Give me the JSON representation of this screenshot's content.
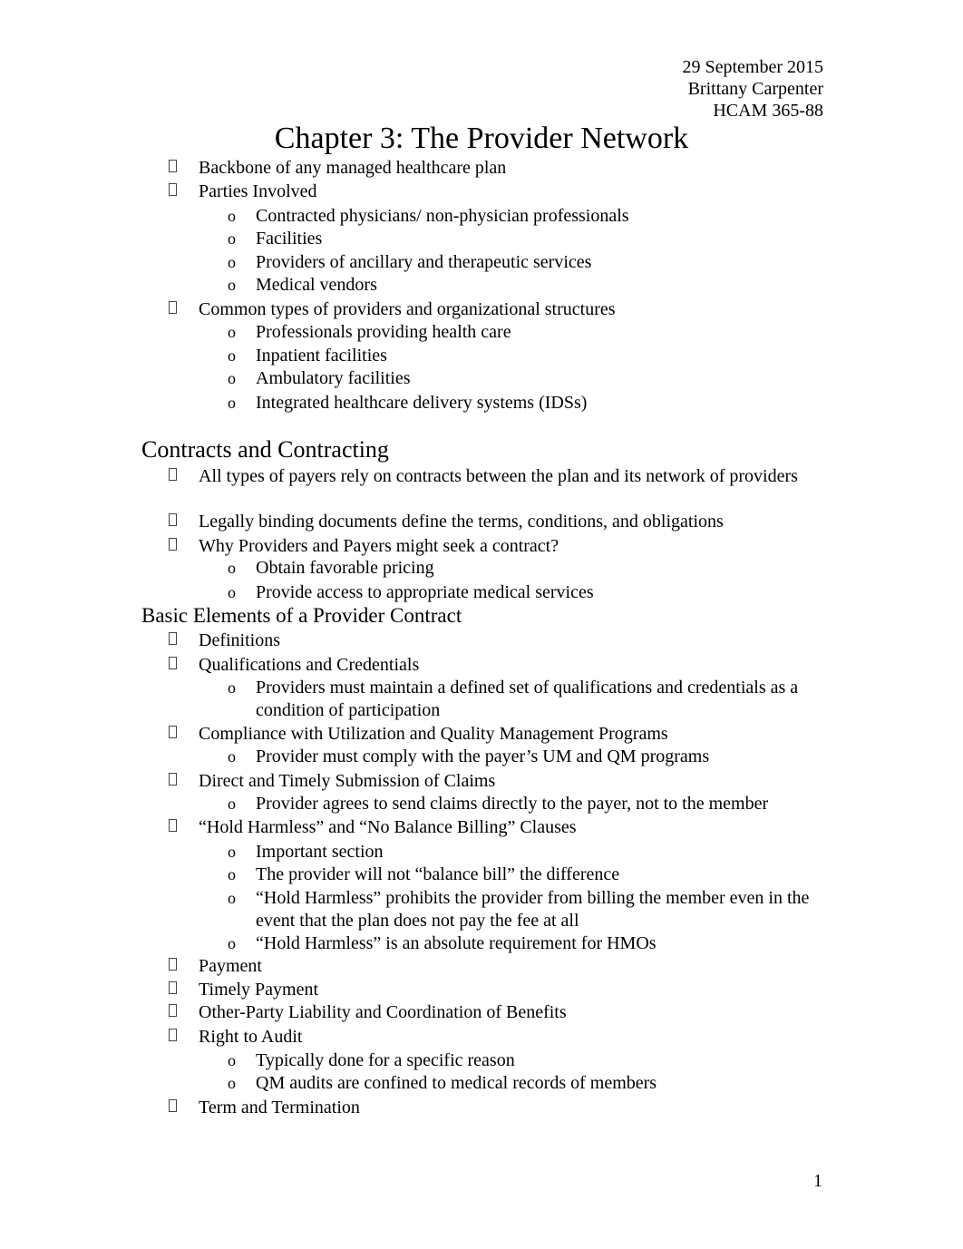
{
  "header": {
    "date": "29 September 2015",
    "author": "Brittany Carpenter",
    "course": "HCAM 365-88"
  },
  "title": "Chapter 3: The Provider Network",
  "bullet_glyphs": {
    "level1": "missing-glyph-box",
    "level2": "o"
  },
  "sections": [
    {
      "heading": "",
      "items": [
        {
          "text": "Backbone of any managed healthcare plan",
          "sub": []
        },
        {
          "text": "Parties Involved",
          "sub": [
            "Contracted physicians/ non-physician professionals",
            "Facilities",
            "Providers of ancillary and therapeutic services",
            "Medical vendors"
          ]
        },
        {
          "text": "Common types of providers and organizational structures",
          "sub": [
            "Professionals providing health care",
            "Inpatient facilities",
            "Ambulatory facilities",
            "Integrated healthcare delivery systems (IDSs)"
          ]
        }
      ]
    },
    {
      "heading": "Contracts and Contracting",
      "items": [
        {
          "text": "All types of payers rely on contracts between the plan and its network of providers",
          "sub": []
        },
        {
          "text": "Legally binding documents define the terms, conditions, and obligations",
          "sub": []
        },
        {
          "text": "Why Providers and Payers might seek a contract?",
          "sub": [
            "Obtain favorable pricing",
            "Provide access to appropriate medical services"
          ]
        }
      ]
    },
    {
      "heading": "Basic Elements of a Provider Contract",
      "items": [
        {
          "text": "Definitions",
          "sub": []
        },
        {
          "text": "Qualifications and Credentials",
          "sub": [
            "Providers must maintain a defined set of qualifications and credentials as a condition of participation"
          ]
        },
        {
          "text": "Compliance with Utilization and Quality Management Programs",
          "sub": [
            "Provider must comply with the payer’s UM and QM programs"
          ]
        },
        {
          "text": "Direct and Timely Submission of Claims",
          "sub": [
            "Provider agrees to send claims directly to the payer, not to the member"
          ]
        },
        {
          "text": "“Hold Harmless” and “No Balance Billing” Clauses",
          "sub": [
            "Important section",
            "The provider will not “balance bill” the difference",
            "“Hold Harmless” prohibits the provider from billing the member even in the event that the plan does not pay the fee at all",
            "“Hold Harmless” is an absolute requirement for HMOs"
          ]
        },
        {
          "text": "Payment",
          "sub": []
        },
        {
          "text": "Timely Payment",
          "sub": []
        },
        {
          "text": "Other-Party Liability and Coordination of Benefits",
          "sub": []
        },
        {
          "text": "Right to Audit",
          "sub": [
            "Typically done for a specific reason",
            "QM audits are confined to medical records of members"
          ]
        },
        {
          "text": "Term and Termination",
          "sub": []
        }
      ]
    }
  ],
  "page_number": "1"
}
